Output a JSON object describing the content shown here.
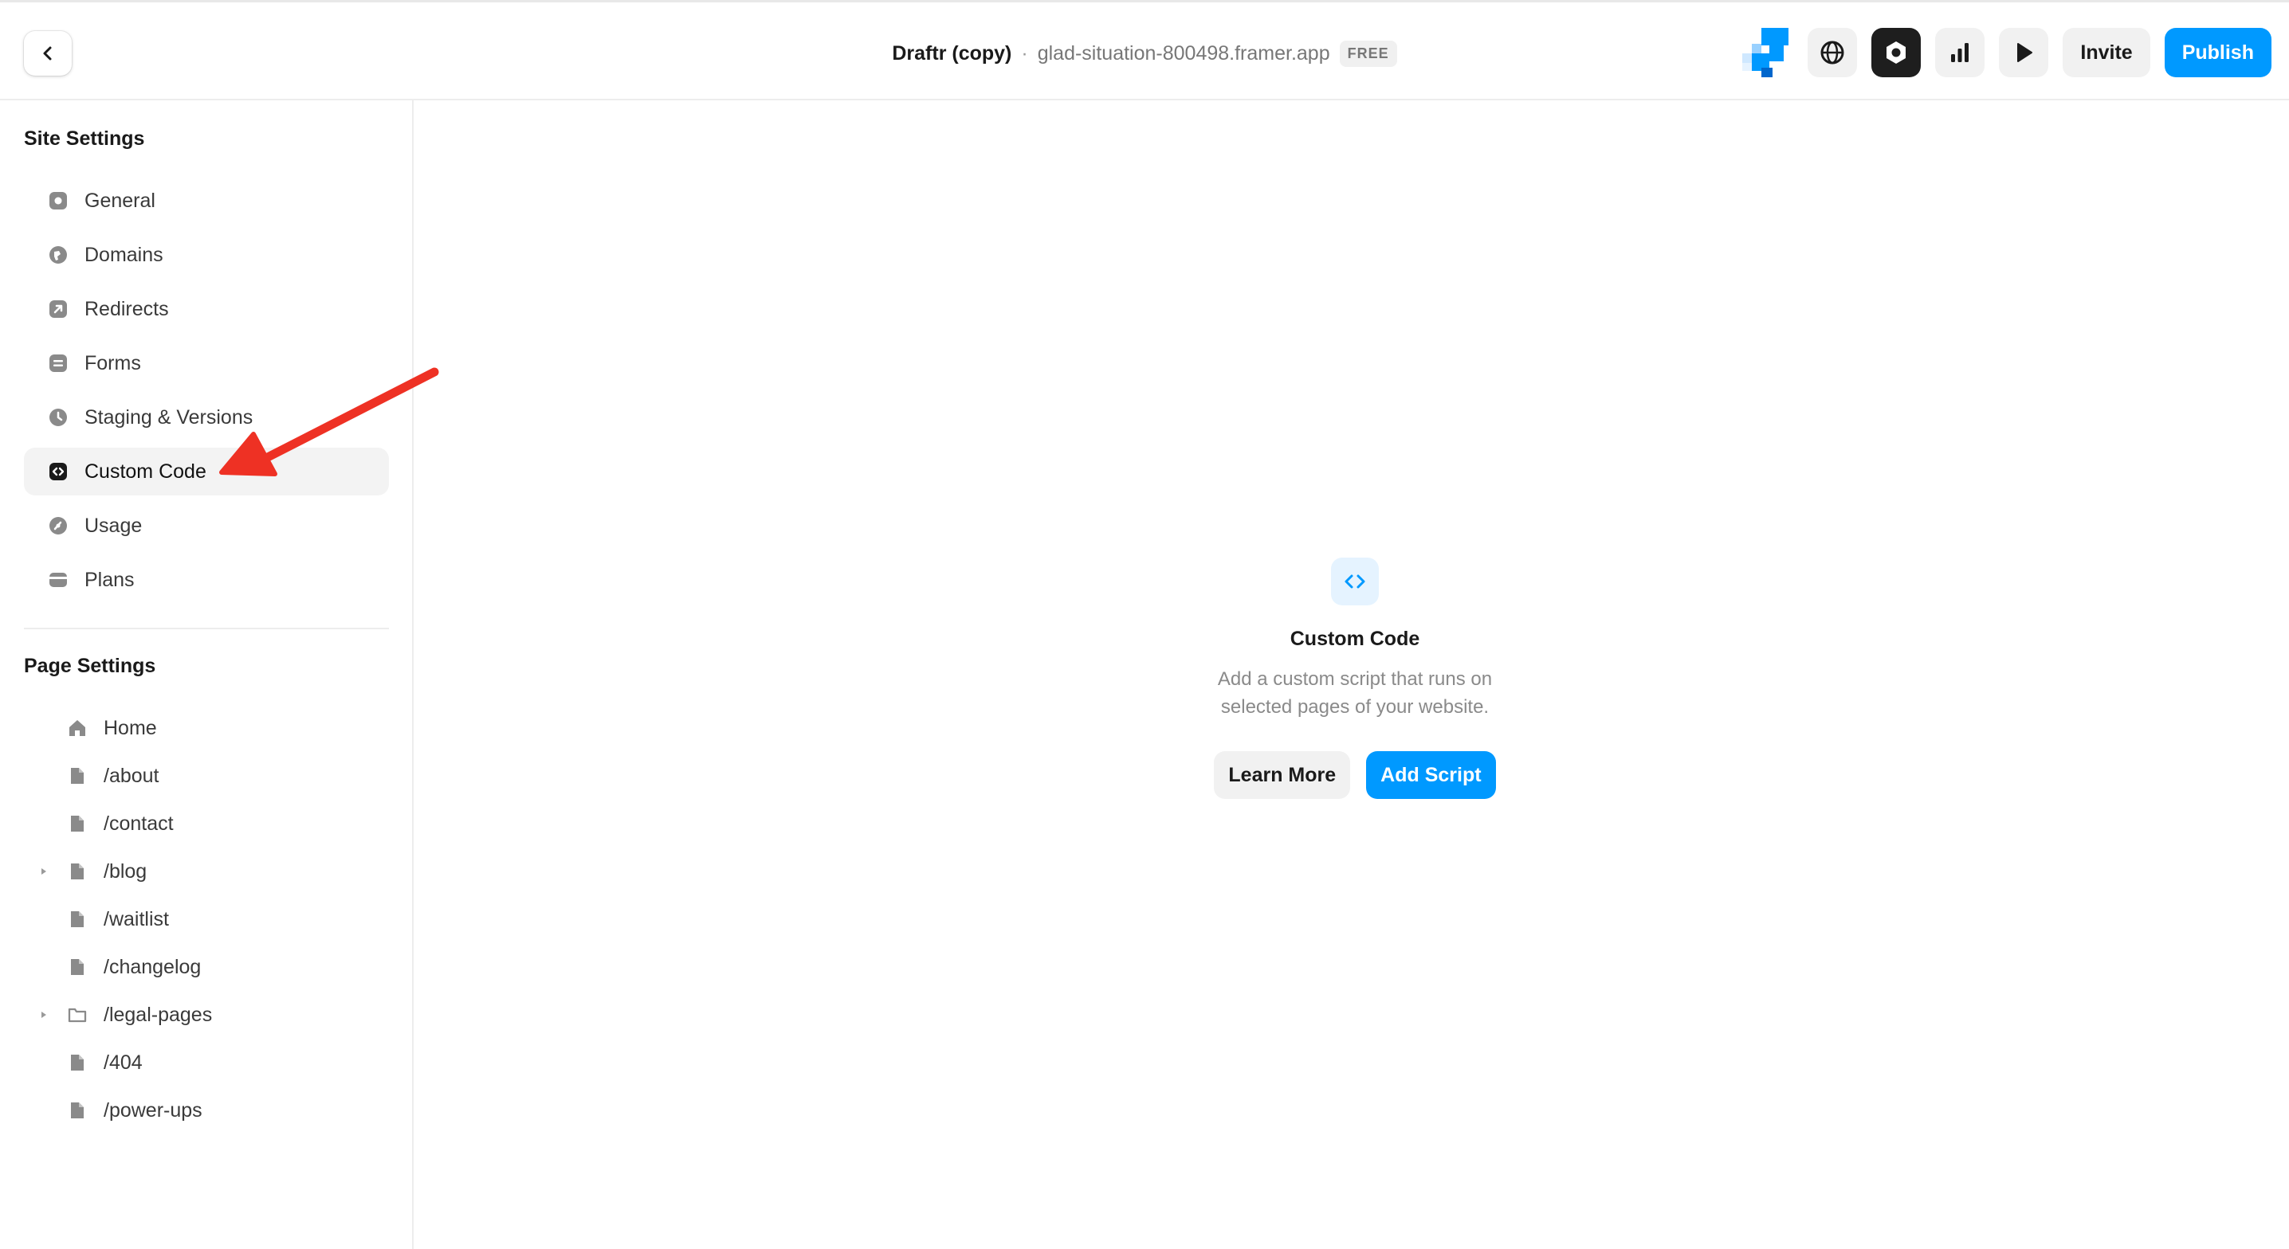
{
  "header": {
    "project_name": "Draftr (copy)",
    "separator": "·",
    "project_url": "glad-situation-800498.framer.app",
    "plan_badge": "FREE",
    "invite_label": "Invite",
    "publish_label": "Publish"
  },
  "sidebar": {
    "site_settings_title": "Site Settings",
    "site_items": [
      {
        "label": "General",
        "icon": "gear-square-icon"
      },
      {
        "label": "Domains",
        "icon": "globe-icon"
      },
      {
        "label": "Redirects",
        "icon": "redirect-arrow-icon"
      },
      {
        "label": "Forms",
        "icon": "form-icon"
      },
      {
        "label": "Staging & Versions",
        "icon": "clock-icon"
      },
      {
        "label": "Custom Code",
        "icon": "code-icon",
        "active": true
      },
      {
        "label": "Usage",
        "icon": "gauge-icon"
      },
      {
        "label": "Plans",
        "icon": "card-icon"
      }
    ],
    "page_settings_title": "Page Settings",
    "pages": [
      {
        "label": "Home",
        "icon": "home-icon",
        "expandable": false
      },
      {
        "label": "/about",
        "icon": "file-icon",
        "expandable": false
      },
      {
        "label": "/contact",
        "icon": "file-icon",
        "expandable": false
      },
      {
        "label": "/blog",
        "icon": "file-icon",
        "expandable": true
      },
      {
        "label": "/waitlist",
        "icon": "file-icon",
        "expandable": false
      },
      {
        "label": "/changelog",
        "icon": "file-icon",
        "expandable": false
      },
      {
        "label": "/legal-pages",
        "icon": "folder-icon",
        "expandable": true
      },
      {
        "label": "/404",
        "icon": "file-icon",
        "expandable": false
      },
      {
        "label": "/power-ups",
        "icon": "file-icon",
        "expandable": false
      }
    ]
  },
  "main": {
    "title": "Custom Code",
    "description": "Add a custom script that runs on selected pages of your website.",
    "learn_more_label": "Learn More",
    "add_script_label": "Add Script"
  },
  "colors": {
    "accent": "#0099ff",
    "annotation_arrow": "#ee3124"
  }
}
